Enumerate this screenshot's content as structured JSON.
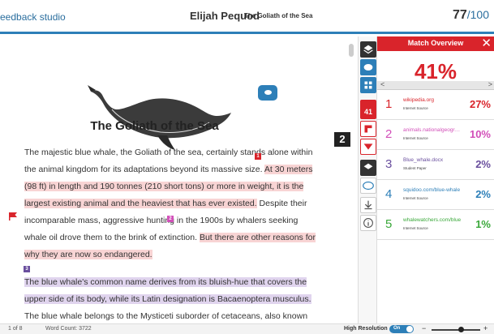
{
  "header": {
    "brand": "eedback studio",
    "student": "Elijah Pequod",
    "paper_title": "The Goliath of the Sea",
    "score": "77",
    "score_total": "/100"
  },
  "document": {
    "title": "The Goliath of the Sea",
    "p1": {
      "a": "The majestic blue whale, the Goliath of the sea, certainly stands alone within the animal kingdom for its adaptations beyond its massive size.",
      "b": "At 30 meters (98 ft) in length and 190 tonnes (210 short tons) or more in weight, it is the largest existing animal and the heaviest that has ever existed.",
      "c": "Despite their incomparable mass, aggressive hunting in the 1900s by whalers seeking whale oil drove them to the brink of extinction.",
      "d": "But there are other reasons for why they are now so endangered."
    },
    "p2": {
      "a": "The blue whale's common name derives from its bluish-hue that covers the upper side of its body, while its Latin designation is Bacaenoptera musculus.",
      "b": "The blue whale belongs to the Mysticeti suborder of cetaceans, also known as baleen"
    },
    "markers": [
      "1",
      "2",
      "3"
    ],
    "flag_number": "2"
  },
  "toolbar": {
    "match_count": "41"
  },
  "panel": {
    "title": "Match Overview",
    "close": "✕",
    "overall": "41%",
    "prev": "<",
    "next": ">",
    "matches": [
      {
        "rank": "1",
        "source": "wikipedia.org",
        "type": "Internet Source",
        "pct": "27%",
        "color": "#d9242b"
      },
      {
        "rank": "2",
        "source": "animals.nationalgeogra...",
        "type": "Internet Source",
        "pct": "10%",
        "color": "#d24fb9"
      },
      {
        "rank": "3",
        "source": "Blue_whale.docx",
        "type": "Student Paper",
        "pct": "2%",
        "color": "#6a4f9e"
      },
      {
        "rank": "4",
        "source": "squidoo.com/blue-whale",
        "type": "Internet Source",
        "pct": "2%",
        "color": "#2d7fb8"
      },
      {
        "rank": "5",
        "source": "whalewatchers.com/blue",
        "type": "Internet Source",
        "pct": "1%",
        "color": "#3aa83a"
      }
    ]
  },
  "footer": {
    "page": "1 of 8",
    "word_count": "Word Count: 3722",
    "high_res": "High Resolution",
    "toggle": "On",
    "zoom_out": "−",
    "zoom_in": "+"
  }
}
